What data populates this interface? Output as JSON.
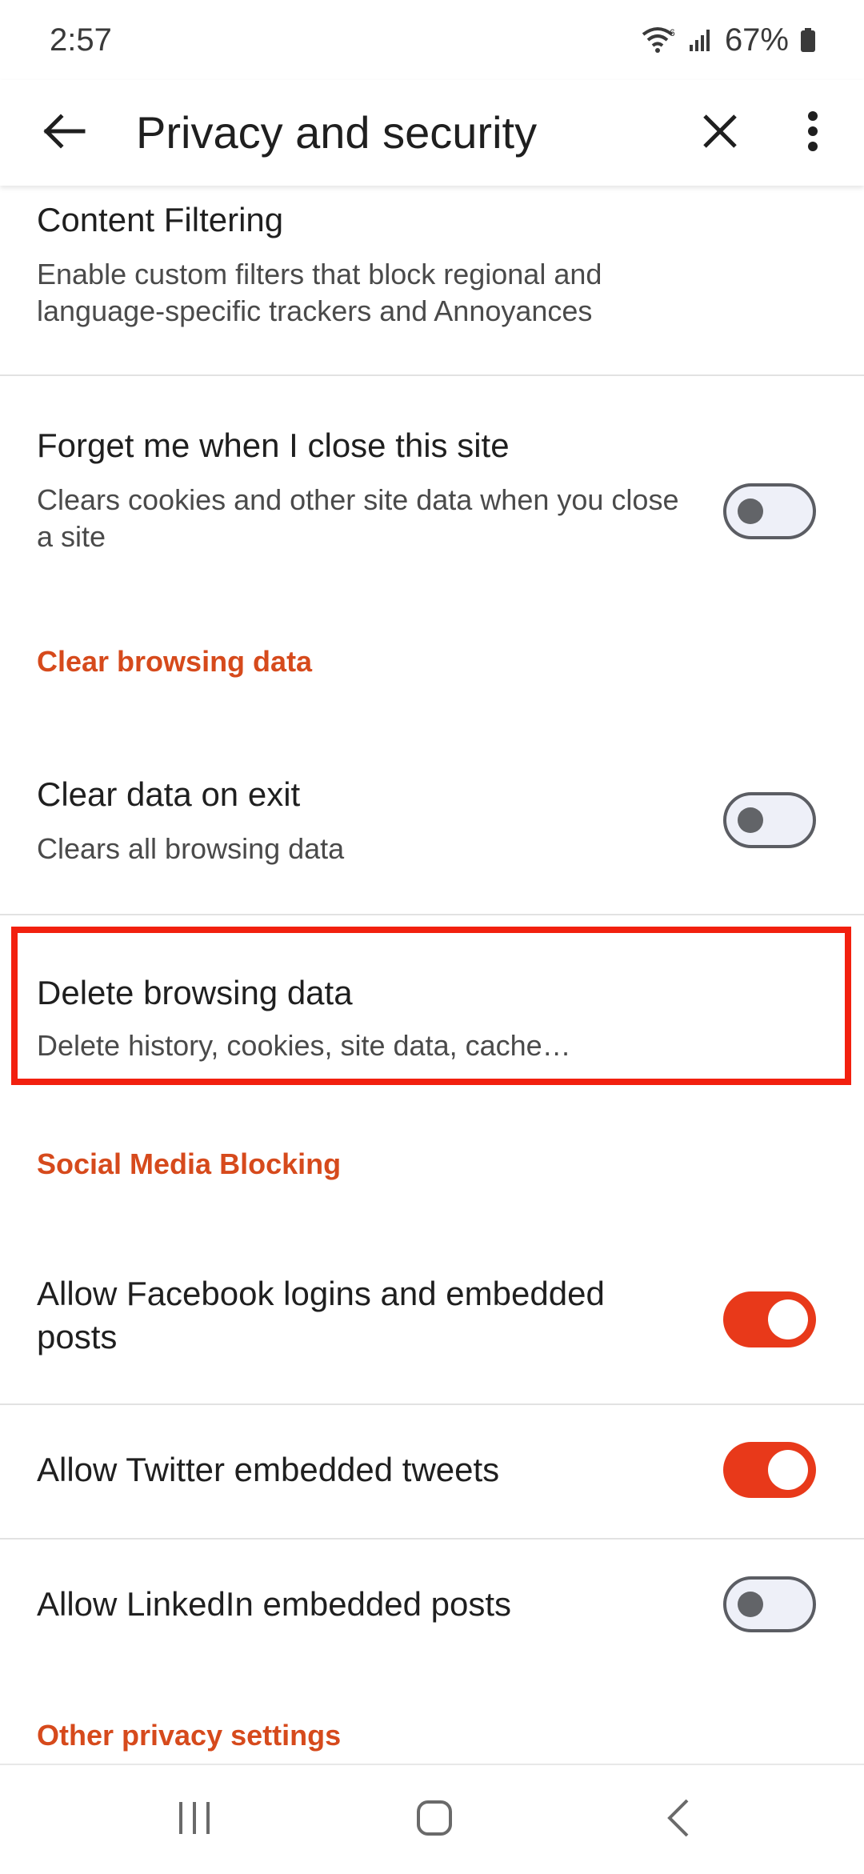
{
  "status_bar": {
    "time": "2:57",
    "battery": "67%",
    "icons": [
      "wifi-icon",
      "signal-icon",
      "battery-icon"
    ]
  },
  "app_bar": {
    "title": "Privacy and security",
    "back_icon": "arrow-left-icon",
    "close_icon": "close-icon",
    "more_icon": "more-vert-icon"
  },
  "colors": {
    "accent": "#e8391a",
    "section_header": "#d64a1c",
    "highlight": "#f2200f",
    "toggle_off_track": "#eef0f8"
  },
  "settings": {
    "content_filtering": {
      "title": "Content Filtering",
      "subtitle": "Enable custom filters that block regional and language-specific trackers and Annoyances"
    },
    "forget_me": {
      "title": "Forget me when I close this site",
      "subtitle": "Clears cookies and other site data when you close a site",
      "enabled": false
    },
    "section_clear": "Clear browsing data",
    "clear_on_exit": {
      "title": "Clear data on exit",
      "subtitle": "Clears all browsing data",
      "enabled": false
    },
    "delete_browsing": {
      "title": "Delete browsing data",
      "subtitle": "Delete history, cookies, site data, cache…"
    },
    "section_social": "Social Media Blocking",
    "facebook": {
      "title": "Allow Facebook logins and embedded posts",
      "enabled": true
    },
    "twitter": {
      "title": "Allow Twitter embedded tweets",
      "enabled": true
    },
    "linkedin": {
      "title": "Allow LinkedIn embedded posts",
      "enabled": false
    },
    "section_other": "Other privacy settings"
  },
  "nav_bar": {
    "recents_icon": "recents-icon",
    "home_icon": "home-icon",
    "back_icon": "nav-back-icon"
  }
}
